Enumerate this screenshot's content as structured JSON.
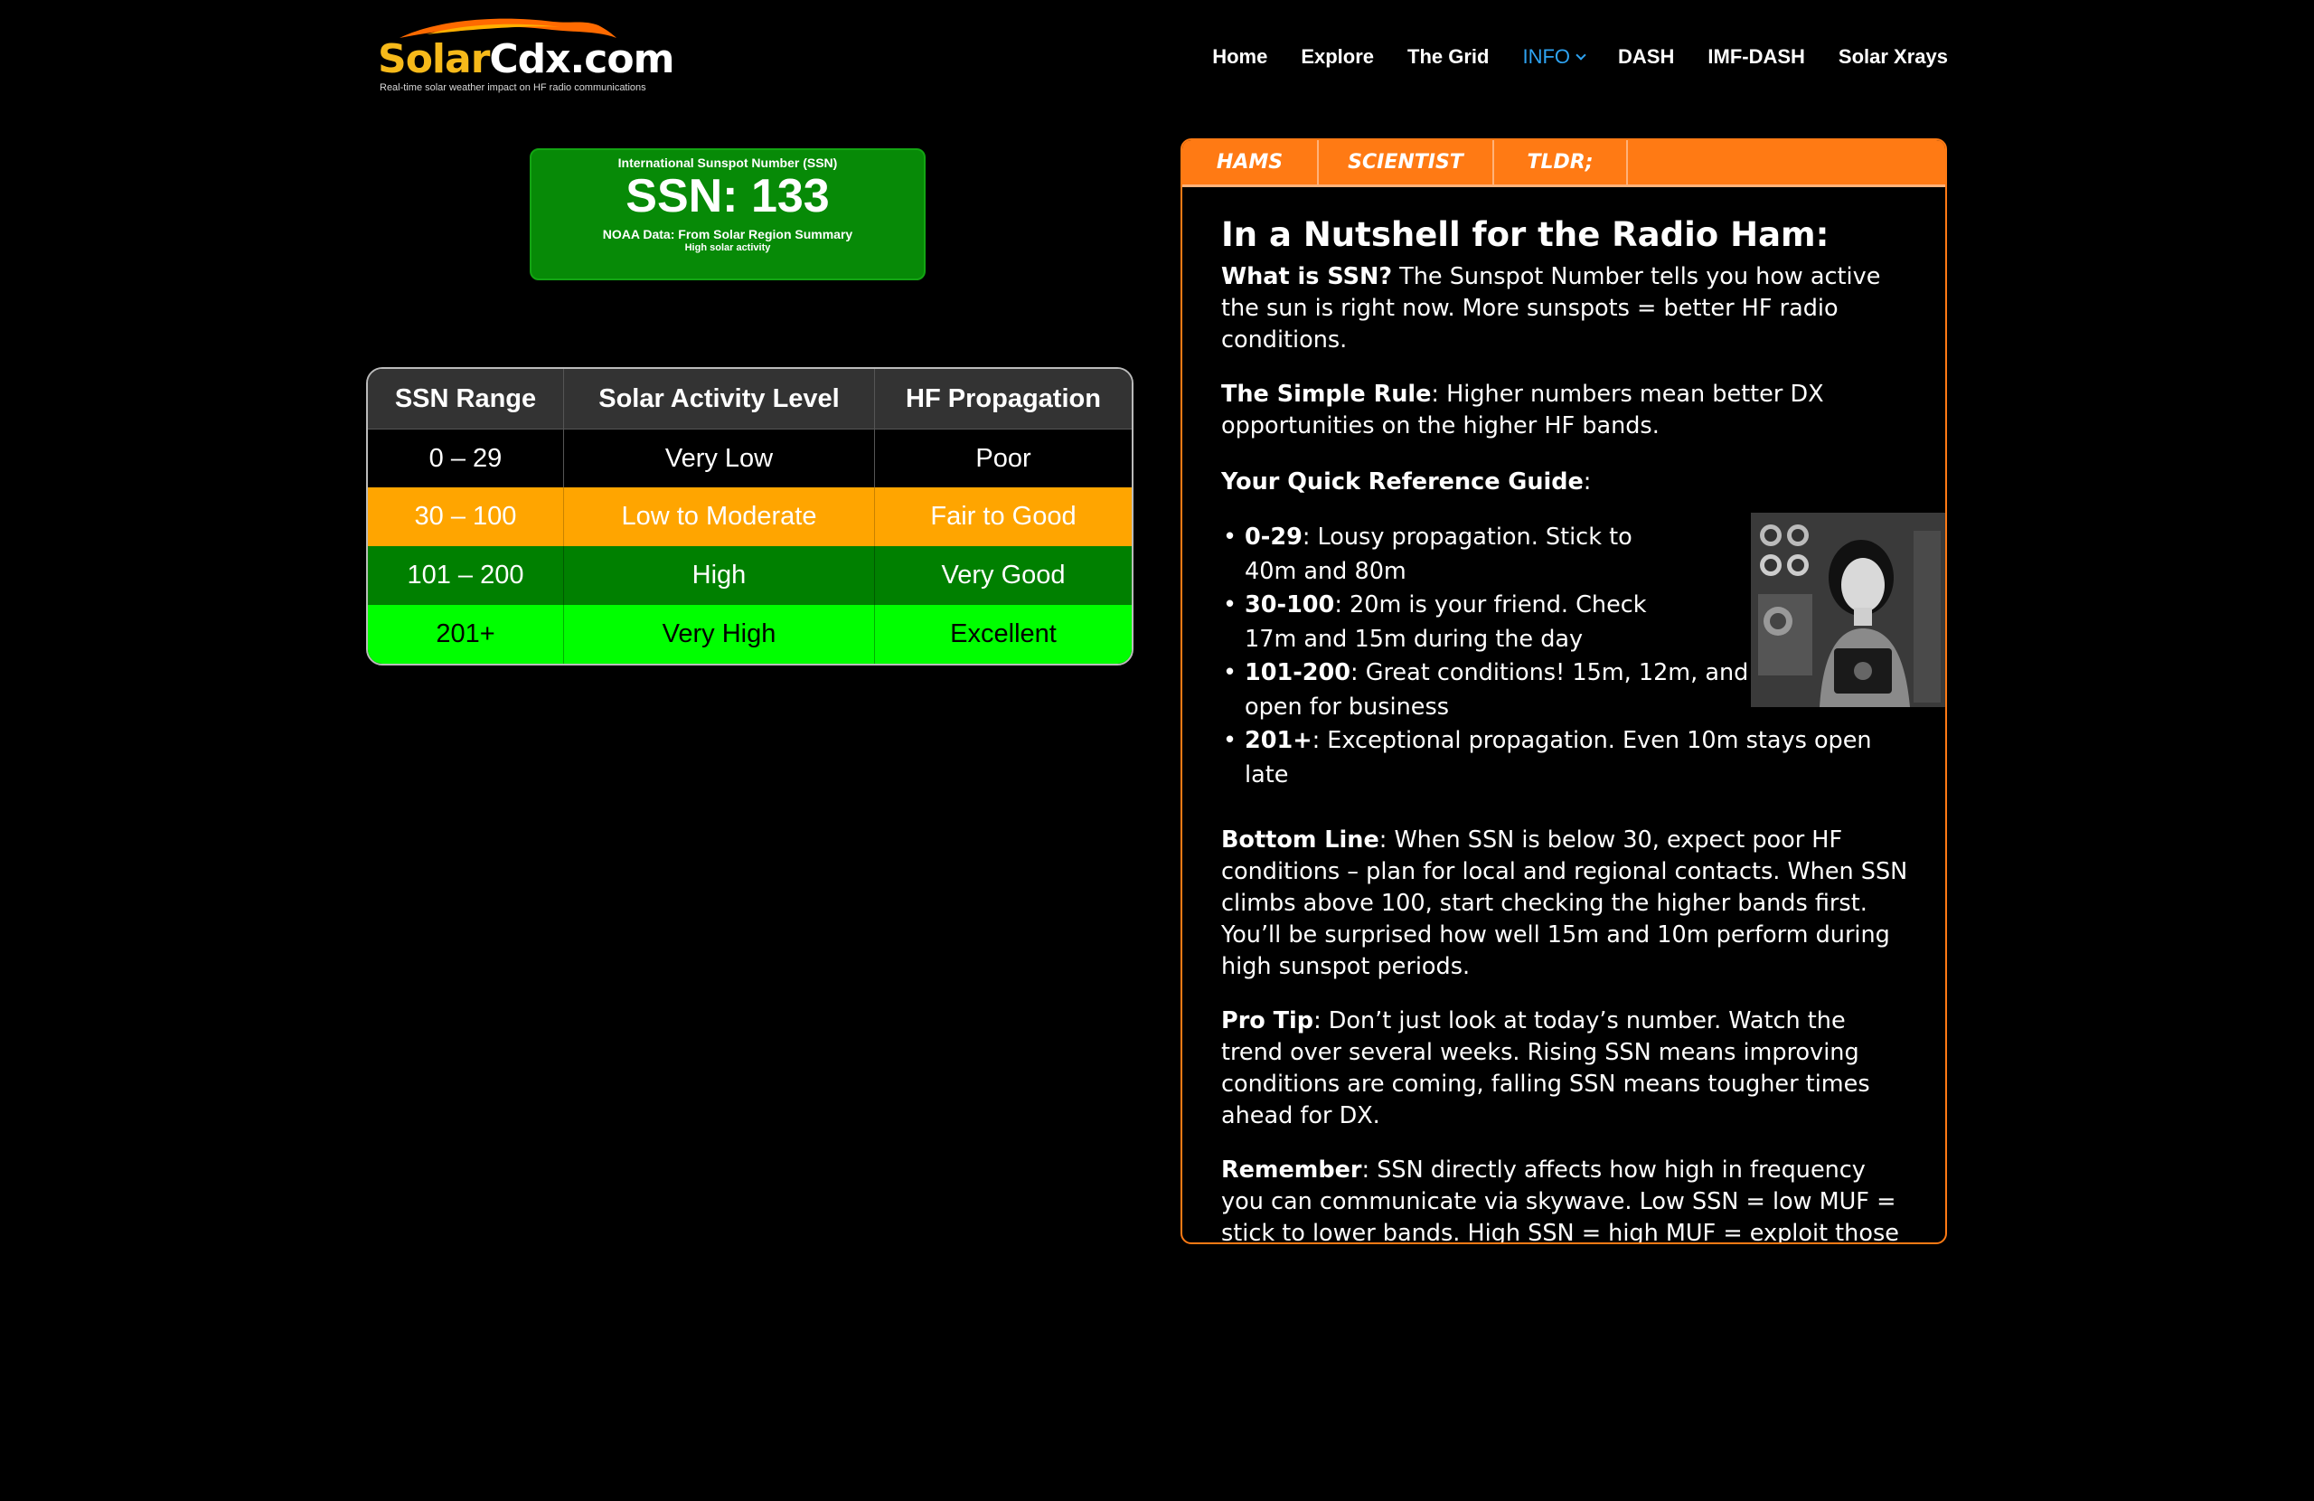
{
  "logo": {
    "brand_part1": "Solar",
    "brand_part2": "Cdx.com",
    "tagline": "Real-time solar weather impact on HF radio communications"
  },
  "nav": {
    "items": [
      "Home",
      "Explore",
      "The Grid",
      "INFO",
      "DASH",
      "IMF-DASH",
      "Solar Xrays"
    ],
    "active": "INFO"
  },
  "ssn_widget": {
    "title": "International Sunspot Number (SSN)",
    "value_text": "SSN: 133",
    "source": "NOAA Data: From Solar Region Summary",
    "level": "High solar activity",
    "color": "#078a07"
  },
  "ssn_table": {
    "headers": [
      "SSN Range",
      "Solar Activity Level",
      "HF Propagation"
    ],
    "rows": [
      [
        "0 – 29",
        "Very Low",
        "Poor"
      ],
      [
        "30 – 100",
        "Low to Moderate",
        "Fair to Good"
      ],
      [
        "101 – 200",
        "High",
        "Very Good"
      ],
      [
        "201+",
        "Very High",
        "Excellent"
      ]
    ],
    "row_colors": [
      "#000000",
      "#ffa500",
      "#008000",
      "#00ff00"
    ]
  },
  "panel": {
    "tabs": [
      "HAMS",
      "SCIENTIST",
      "TLDR;"
    ],
    "accent": "#ff7a14",
    "heading": "In a Nutshell for the Radio Ham:",
    "what_label": "What is SSN?",
    "what_text": " The Sunspot Number tells you how active the sun is right now. More sunspots = better HF radio conditions.",
    "rule_label": "The Simple Rule",
    "rule_text": ": Higher numbers mean better DX opportunities on the higher HF bands.",
    "guide_label": "Your Quick Reference Guide",
    "guide_suffix": ":",
    "guide_items": [
      {
        "label": "0-29",
        "text": ": Lousy propagation. Stick to 40m and 80m"
      },
      {
        "label": "30-100",
        "text": ": 20m is your friend. Check 17m and 15m during the day"
      },
      {
        "label": "101-200",
        "text": ": Great conditions! 15m, 12m, and 10m are open for business"
      },
      {
        "label": "201+",
        "text": ": Exceptional propagation. Even 10m stays open late"
      }
    ],
    "bottom_label": "Bottom Line",
    "bottom_text": ": When SSN is below 30, expect poor HF conditions – plan for local and regional contacts. When SSN climbs above 100, start checking the higher bands first. You’ll be surprised how well 15m and 10m perform during high sunspot periods.",
    "tip_label": "Pro Tip",
    "tip_text": ": Don’t just look at today’s number. Watch the trend over several weeks. Rising SSN means improving conditions are coming, falling SSN means tougher times ahead for DX.",
    "remember_label": "Remember",
    "remember_text": ": SSN directly affects how high in frequency you can communicate via skywave. Low SSN = low MUF = stick to lower bands. High SSN = high MUF = exploit those higher bands for amazing DX!",
    "portrait_icon": "vintage-radio-operator-portrait"
  }
}
